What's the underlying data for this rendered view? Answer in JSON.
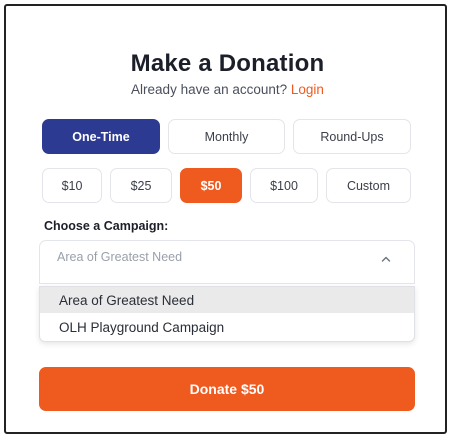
{
  "form": {
    "title": "Make a Donation",
    "subtitle_prefix": "Already have an account? ",
    "login_link": "Login"
  },
  "frequency": {
    "options": [
      "One-Time",
      "Monthly",
      "Round-Ups"
    ],
    "selected": "One-Time"
  },
  "amounts": {
    "options": [
      "$10",
      "$25",
      "$50",
      "$100",
      "Custom"
    ],
    "selected": "$50"
  },
  "campaign": {
    "label": "Choose a Campaign:",
    "selected_value": "Area of Greatest Need",
    "dropdown_open": true,
    "options": [
      "Area of Greatest Need",
      "OLH Playground Campaign"
    ],
    "highlighted": "Area of Greatest Need"
  },
  "donate_button": {
    "label": "Donate $50"
  },
  "colors": {
    "primary_blue": "#2d3a91",
    "accent_orange": "#ef5a1f"
  },
  "icons": {
    "dropdown_chevron": "chevron-up-icon"
  }
}
